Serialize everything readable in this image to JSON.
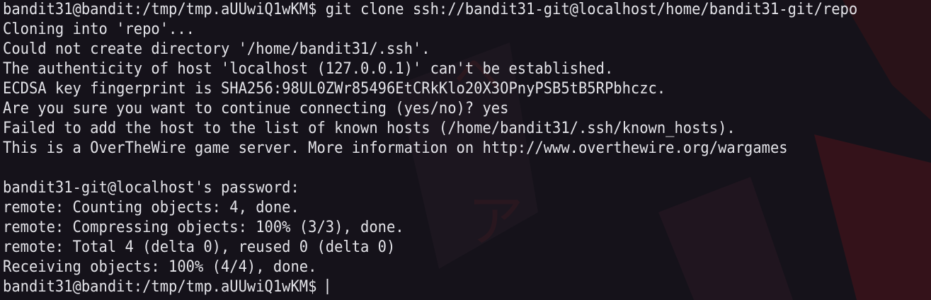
{
  "colors": {
    "background": "#15121a",
    "text": "#e3e3e8",
    "wallpaper_accent": "#7a1e22"
  },
  "terminal": {
    "lines": [
      "bandit31@bandit:/tmp/tmp.aUUwiQ1wKM$ git clone ssh://bandit31-git@localhost/home/bandit31-git/repo",
      "Cloning into 'repo'...",
      "Could not create directory '/home/bandit31/.ssh'.",
      "The authenticity of host 'localhost (127.0.0.1)' can't be established.",
      "ECDSA key fingerprint is SHA256:98UL0ZWr85496EtCRkKlo20X3OPnyPSB5tB5RPbhczc.",
      "Are you sure you want to continue connecting (yes/no)? yes",
      "Failed to add the host to the list of known hosts (/home/bandit31/.ssh/known_hosts).",
      "This is a OverTheWire game server. More information on http://www.overthewire.org/wargames",
      "",
      "bandit31-git@localhost's password:",
      "remote: Counting objects: 4, done.",
      "remote: Compressing objects: 100% (3/3), done.",
      "remote: Total 4 (delta 0), reused 0 (delta 0)",
      "Receiving objects: 100% (4/4), done."
    ],
    "prompt": "bandit31@bandit:/tmp/tmp.aUUwiQ1wKM$ "
  }
}
